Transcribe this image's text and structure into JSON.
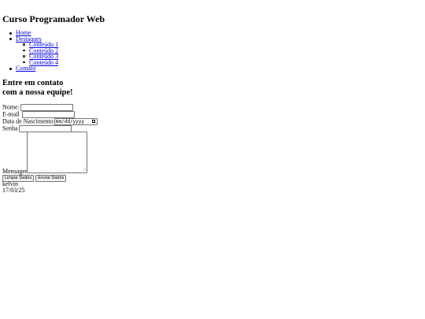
{
  "header": {
    "title": "Curso Programador Web"
  },
  "nav": {
    "items": [
      {
        "label": "Home"
      },
      {
        "label": "Destaques",
        "children": [
          {
            "label": "Conteúdo 1"
          },
          {
            "label": "Conteúdo 2"
          },
          {
            "label": "Conteúdo 3"
          },
          {
            "label": "Conteúdo 4"
          }
        ]
      },
      {
        "label": "Contato"
      }
    ]
  },
  "contact": {
    "heading_line1": "Entre em contato",
    "heading_line2": "com a nossa equipe!",
    "name_label": "Nome:",
    "name_value": "",
    "email_label": "E-mail",
    "email_value": "",
    "birthdate_label": "Data de Nascimento",
    "birthdate_placeholder": "mm/dd/yyyy",
    "password_label": "Senha",
    "password_value": "",
    "message_label": "Mensagem",
    "message_value": "",
    "clear_button": "Limpar Dados",
    "submit_button": "Enviar Dados"
  },
  "footer": {
    "author": "kelvin",
    "date": "17/03/25"
  },
  "colors": {
    "link": "#0000ee",
    "text": "#000000",
    "background": "#ffffff",
    "button_bg": "#efefef",
    "input_border": "#767676"
  }
}
